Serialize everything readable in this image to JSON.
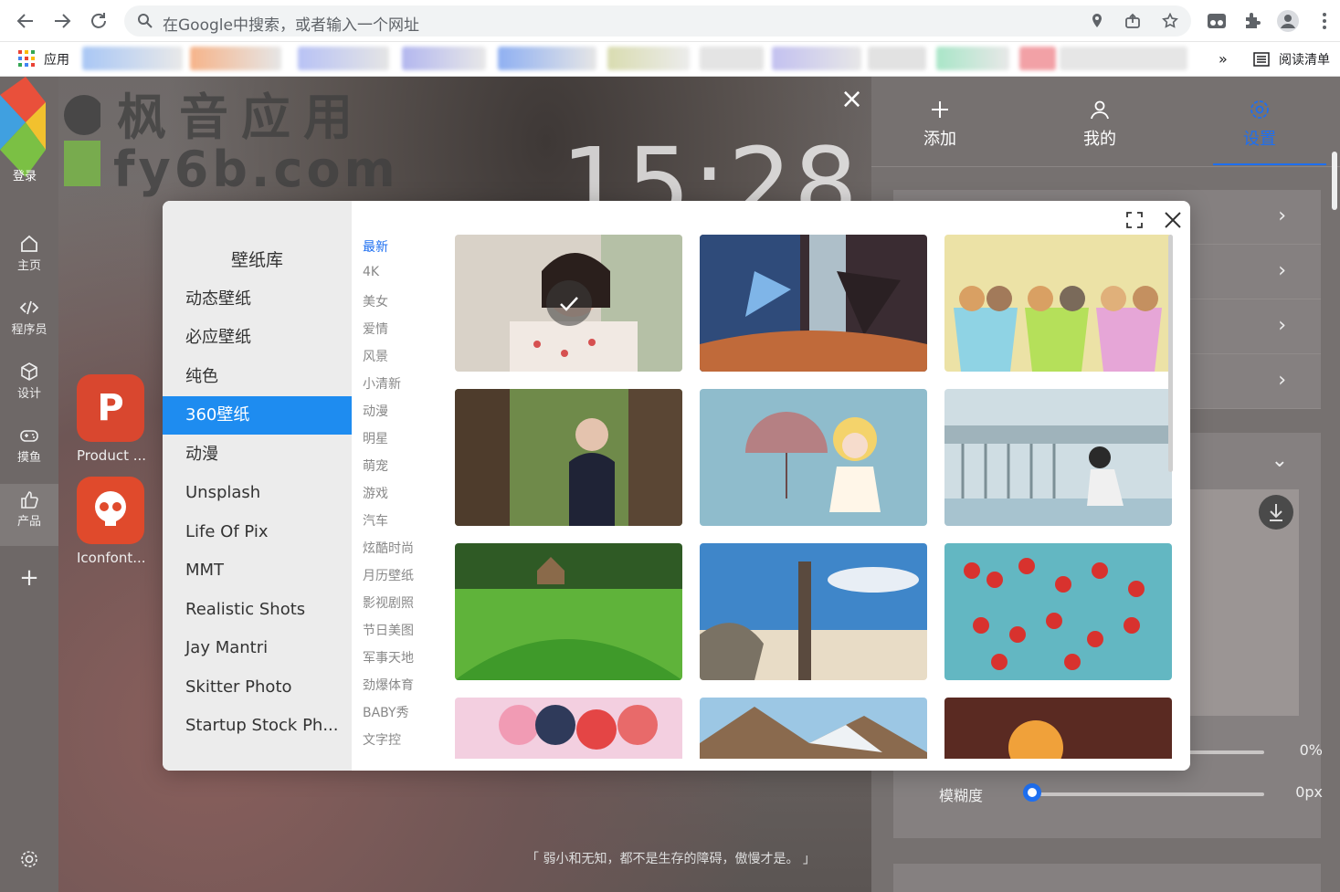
{
  "browser": {
    "search_placeholder": "在Google中搜索，或者输入一个网址",
    "bookmarks_apps_label": "应用",
    "bookmarks_overflow": "»",
    "reading_list_label": "阅读清单"
  },
  "left_nav": {
    "login_label": "登录",
    "items": [
      {
        "label": "主页",
        "icon": "home-icon"
      },
      {
        "label": "程序员",
        "icon": "code-icon"
      },
      {
        "label": "设计",
        "icon": "cube-icon"
      },
      {
        "label": "摸鱼",
        "icon": "gamepad-icon"
      },
      {
        "label": "产品",
        "icon": "thumbs-up-icon"
      }
    ],
    "add_label": "+"
  },
  "apps": [
    {
      "name": "Product ...",
      "letter": "P",
      "color": "#d9472f"
    },
    {
      "name": "Iconfont...",
      "letter": "",
      "color": "#e04a2c"
    }
  ],
  "watermark": {
    "cn": "枫音应用",
    "en": "fy6b.com"
  },
  "clock": "15:28",
  "quote": "「 弱小和无知，都不是生存的障碍，傲慢才是。 」",
  "right_panel": {
    "tabs": [
      {
        "label": "添加",
        "icon": "plus-icon"
      },
      {
        "label": "我的",
        "icon": "user-icon"
      },
      {
        "label": "设置",
        "icon": "gear-icon",
        "active": true
      }
    ],
    "mask_value": "0%",
    "blur_label": "模糊度",
    "blur_value": "0px"
  },
  "modal": {
    "title": "壁纸库",
    "categories": [
      "动态壁纸",
      "必应壁纸",
      "纯色",
      "360壁纸",
      "动漫",
      "Unsplash",
      "Life Of Pix",
      "MMT",
      "Realistic Shots",
      "Jay Mantri",
      "Skitter Photo",
      "Startup Stock Ph..."
    ],
    "active_category": "360壁纸",
    "tags": [
      "最新",
      "4K",
      "美女",
      "爱情",
      "风景",
      "小清新",
      "动漫",
      "明星",
      "萌宠",
      "游戏",
      "汽车",
      "炫酷时尚",
      "月历壁纸",
      "影视剧照",
      "节日美图",
      "军事天地",
      "劲爆体育",
      "BABY秀",
      "文字控"
    ],
    "active_tag": "最新",
    "thumbnails": [
      "girl-portrait",
      "game-battle",
      "kittens-in-cups",
      "girl-by-tree",
      "anime-umbrella",
      "anime-balcony",
      "rice-field",
      "beach-post",
      "strawberries",
      "anime-girls",
      "mountains",
      "sunset-cat"
    ],
    "selected_thumbnail": 0
  },
  "colors": {
    "accent": "#1e6ff0",
    "active_category_bg": "#1e8cf0"
  }
}
